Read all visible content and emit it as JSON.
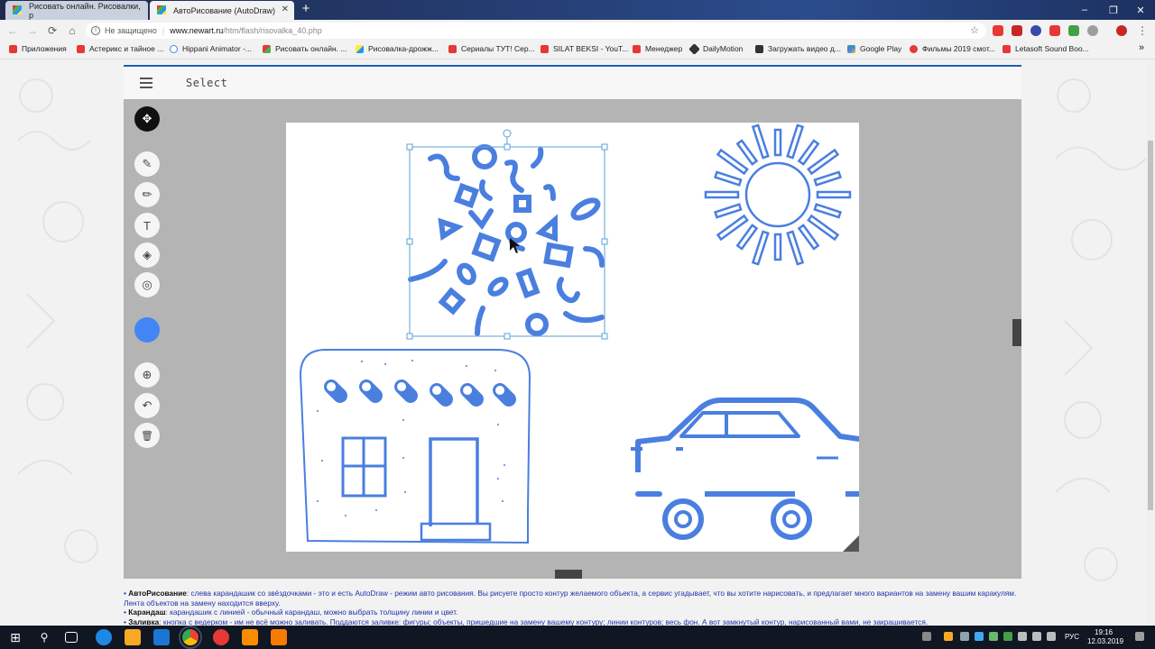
{
  "browser": {
    "tabs": [
      {
        "title": "Рисовать онлайн. Рисовалки, р",
        "active": false
      },
      {
        "title": "АвтоРисование (AutoDraw)",
        "active": true
      }
    ],
    "new_tab": "+",
    "window_controls": [
      "–",
      "❐",
      "✕"
    ],
    "nav": {
      "back": "←",
      "forward": "→",
      "reload": "⟳",
      "home": "⌂"
    },
    "address": {
      "insecure_label": "Не защищено",
      "host": "www.newart.ru",
      "path": "/htm/flash/risovalka_40.php"
    },
    "bookmarks": [
      {
        "label": "Приложения",
        "color": "#e53935"
      },
      {
        "label": "Астерикс и тайное ...",
        "color": "#e53935"
      },
      {
        "label": "Hippani Animator -...",
        "color": "#4285f4"
      },
      {
        "label": "Рисовать онлайн. ...",
        "color": "#ff9800"
      },
      {
        "label": "Рисовалка-дрожж...",
        "color": "#ff9800"
      },
      {
        "label": "Сериалы ТУТ! Сер...",
        "color": "#e53935"
      },
      {
        "label": "SILAT BEKSI - YouT...",
        "color": "#e53935"
      },
      {
        "label": "Менеджер",
        "color": "#e53935"
      },
      {
        "label": "DailyMotion",
        "color": "#333"
      },
      {
        "label": "Загружать видео д...",
        "color": "#333"
      },
      {
        "label": "Google Play",
        "color": "#34a853"
      },
      {
        "label": "Фильмы 2019 смот...",
        "color": "#e53935"
      },
      {
        "label": "Letasoft Sound Boo...",
        "color": "#e53935"
      }
    ],
    "bookmarks_more": "»"
  },
  "app": {
    "mode_label": "Select",
    "accent_color": "#4285f4",
    "tools": [
      {
        "name": "select-tool",
        "icon": "✥",
        "active": true
      },
      {
        "name": "autodraw-tool",
        "icon": "✎",
        "active": false
      },
      {
        "name": "draw-tool",
        "icon": "✏",
        "active": false
      },
      {
        "name": "type-tool",
        "icon": "T",
        "active": false
      },
      {
        "name": "fill-tool",
        "icon": "◈",
        "active": false
      },
      {
        "name": "shape-tool",
        "icon": "◎",
        "active": false
      },
      {
        "name": "color-picker",
        "icon": "",
        "active": false
      },
      {
        "name": "zoom-tool",
        "icon": "⊕",
        "active": false
      },
      {
        "name": "undo-button",
        "icon": "↶",
        "active": false
      },
      {
        "name": "delete-button",
        "icon": "🗑",
        "active": false
      }
    ]
  },
  "help": {
    "lines": [
      {
        "label": "АвтоРисование",
        "text": ": слева карандашик со звёздочками - это и есть AutoDraw - режим авто рисования. Вы рисуете просто контур желаемого объекта, а сервис угадывает, что вы хотите нарисовать, и предлагает много вариантов на замену вашим каракулям. Лента объектов на замену находится вверху."
      },
      {
        "label": "Карандаш",
        "text": ": карандашик с линией - обычный карандаш, можно выбрать толщину линии и цвет."
      },
      {
        "label": "Заливка",
        "text": ": кнопка с ведерком - им не всё можно заливать. Поддаются заливке: фигуры; объекты, пришедшие на замену вашему контуру; линии контуров; весь фон. А вот замкнутый контур, нарисованный вами, не закрашивается."
      }
    ]
  },
  "taskbar": {
    "time": "19:16",
    "date": "12.03.2019",
    "lang": "РУС"
  }
}
